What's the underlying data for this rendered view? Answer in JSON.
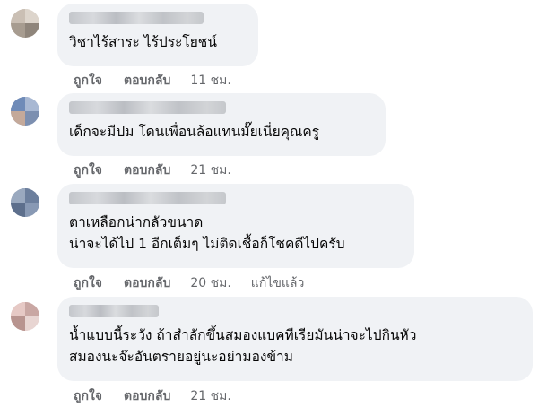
{
  "comments": [
    {
      "text": "วิชาไร้สาระ ไร้ประโยชน์",
      "like_label": "ถูกใจ",
      "reply_label": "ตอบกลับ",
      "time": "11 ชม.",
      "edited": ""
    },
    {
      "text": "เด็กจะมีปม โดนเพื่อนล้อแทนมั๊ยเนี่ยคุณครู",
      "like_label": "ถูกใจ",
      "reply_label": "ตอบกลับ",
      "time": "21 ชม.",
      "edited": ""
    },
    {
      "text": "ตาเหลือกน่ากลัวขนาด\nน่าจะได้ไป 1 อีกเต็มๆ ไม่ติดเชื้อก็โชคดีไปครับ",
      "like_label": "ถูกใจ",
      "reply_label": "ตอบกลับ",
      "time": "20 ชม.",
      "edited": "แก้ไขแล้ว"
    },
    {
      "text": "น้ำแบบนี้ระวัง ถ้าสำลักขึ้นสมองแบคทีเรียมันน่าจะไปกินหัว\nสมองนะจ๊ะอันตรายอยู่นะอย่ามองข้าม",
      "like_label": "ถูกใจ",
      "reply_label": "ตอบกลับ",
      "time": "21 ชม.",
      "edited": ""
    }
  ],
  "colors": {
    "bubble_bg": "#f0f2f5",
    "text": "#050505",
    "meta": "#65676b"
  }
}
